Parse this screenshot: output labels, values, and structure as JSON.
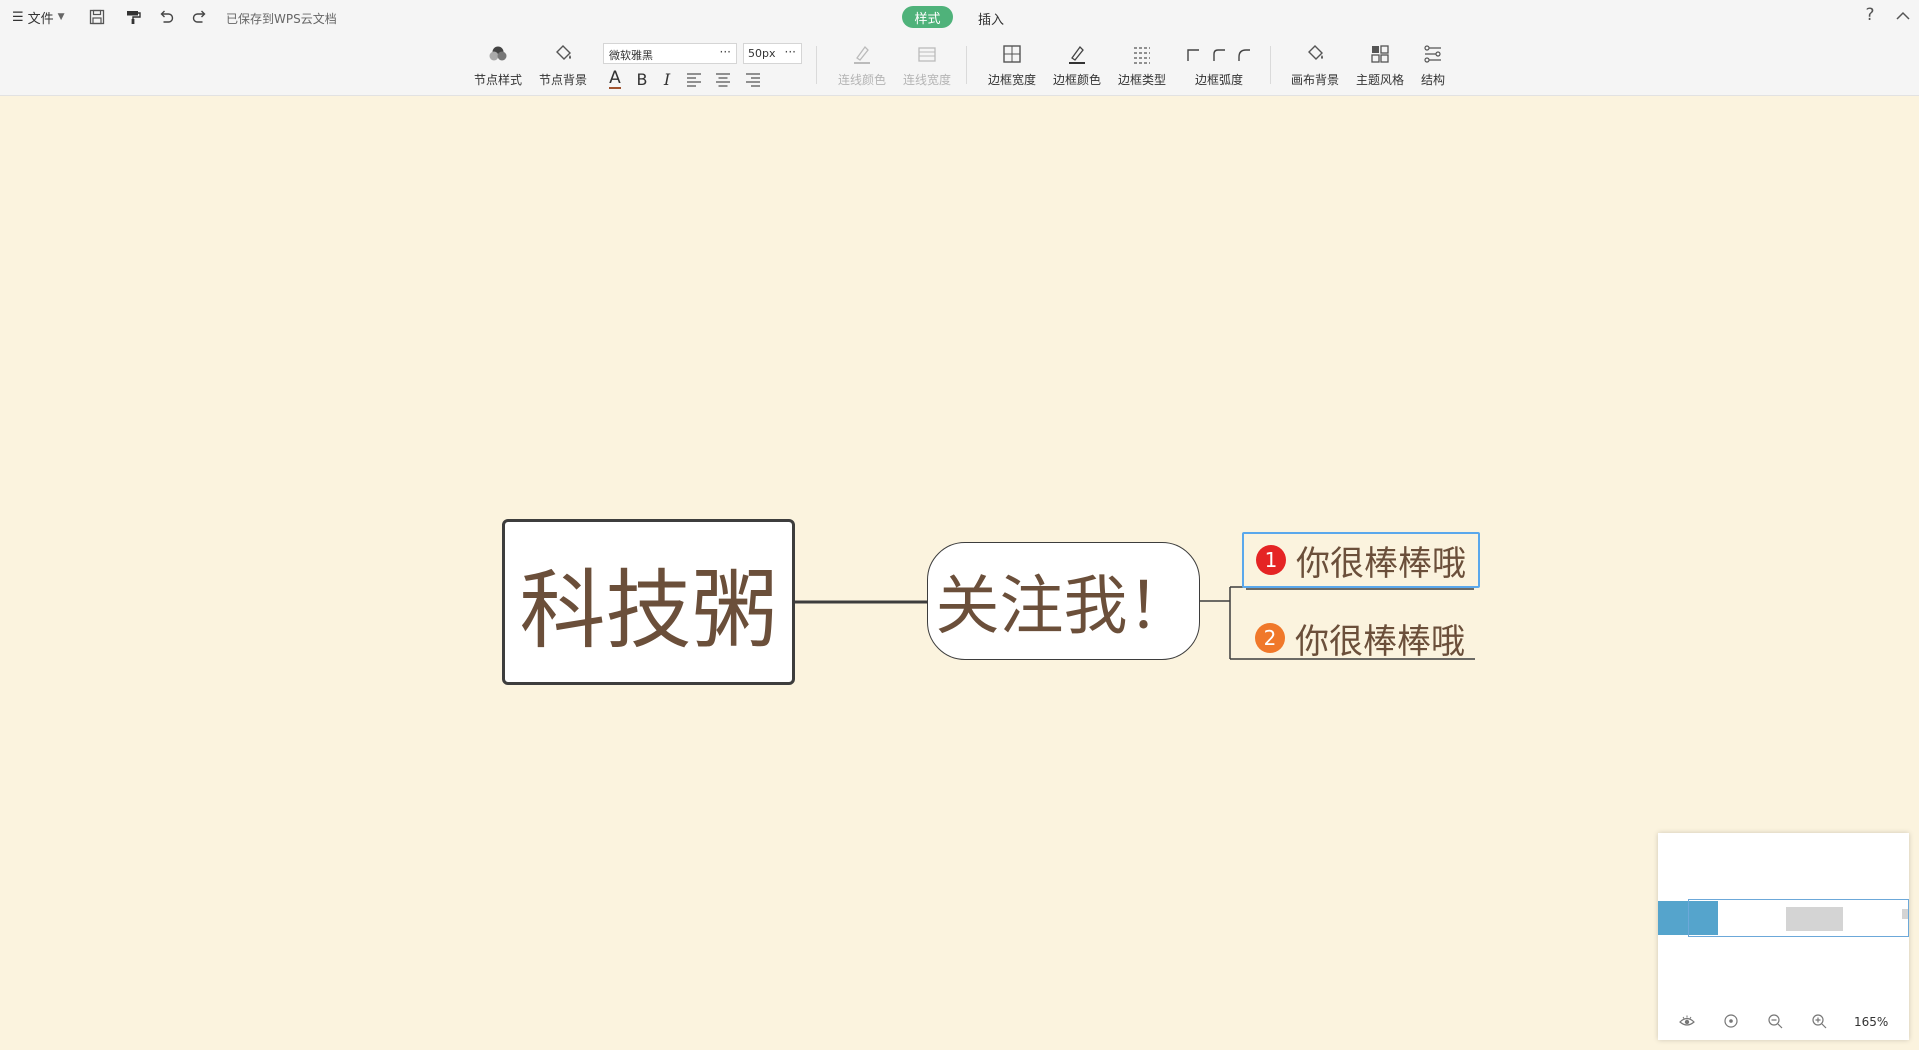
{
  "toolbar": {
    "file_menu_label": "文件",
    "saved_status": "已保存到WPS云文档",
    "tabs": {
      "style": "样式",
      "insert": "插入"
    },
    "help_icon": "?",
    "tools": {
      "node_style": "节点样式",
      "node_background": "节点背景",
      "line_color": "连线颜色",
      "line_width": "连线宽度",
      "border_width": "边框宽度",
      "border_color": "边框颜色",
      "border_type": "边框类型",
      "border_radius": "边框弧度",
      "canvas_background": "画布背景",
      "theme_style": "主题风格",
      "structure": "结构"
    },
    "font": {
      "family": "微软雅黑",
      "size": "50px",
      "more": "···"
    },
    "format_letters": {
      "font_color": "A",
      "bold": "B",
      "italic": "I"
    }
  },
  "mindmap": {
    "root": "科技粥",
    "main": "关注我！",
    "subs": [
      {
        "priority": "1",
        "text": "你很棒棒哦",
        "badge_color": "#e52424"
      },
      {
        "priority": "2",
        "text": "你很棒棒哦",
        "badge_color": "#f0782a"
      }
    ]
  },
  "minimap": {
    "zoom": "165%"
  },
  "colors": {
    "canvas": "#fbf3de",
    "accent_green": "#4fb27a",
    "selection": "#5aa8ec",
    "node_text": "#6b4f3a"
  }
}
